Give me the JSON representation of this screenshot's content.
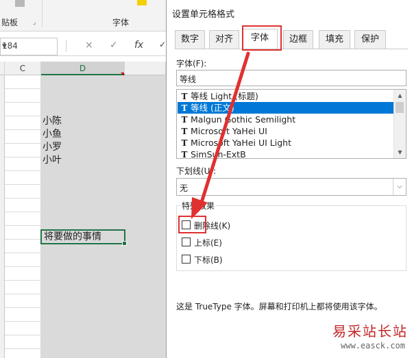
{
  "excel": {
    "ribbon": {
      "clipboard_label": "贴板",
      "font_group_label": "字体"
    },
    "name_box": {
      "value": "184"
    },
    "formula_icons": {
      "cancel": "×",
      "enter": "✓",
      "function": "fx"
    },
    "columns": [
      "C",
      "D"
    ],
    "cells": [
      "小陈",
      "小鱼",
      "小罗",
      "小叶",
      "将要做的事情"
    ]
  },
  "dialog": {
    "title": "设置单元格格式",
    "tabs": [
      "数字",
      "对齐",
      "字体",
      "边框",
      "填充",
      "保护"
    ],
    "active_tab": "字体",
    "font": {
      "label": "字体(F):",
      "value": "等线",
      "list": [
        "等线 Light (标题)",
        "等线 (正文)",
        "Malgun Gothic Semilight",
        "Microsoft YaHei UI",
        "Microsoft YaHei UI Light",
        "SimSun-ExtB"
      ],
      "selected": "等线 (正文)"
    },
    "underline": {
      "label": "下划线(U):",
      "value": "无"
    },
    "effects": {
      "legend": "特殊效果",
      "strikethrough": "删除线(K)",
      "superscript": "上标(E)",
      "subscript": "下标(B)"
    },
    "info": "这是 TrueType 字体。屏幕和打印机上都将使用该字体。"
  },
  "watermark": {
    "cn": "易采站长站",
    "en": "www.easck.com"
  },
  "colors": {
    "highlight": "#e03030",
    "selection": "#0078d7",
    "excel_green": "#217346"
  }
}
